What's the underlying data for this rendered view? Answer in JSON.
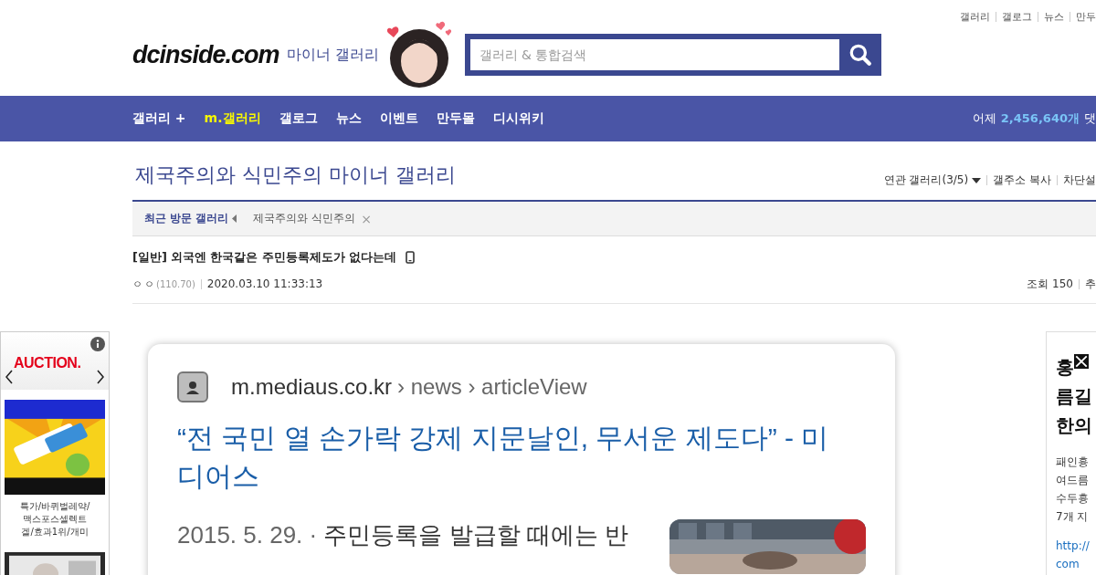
{
  "top_links": [
    "갤러리",
    "갤로그",
    "뉴스",
    "만두"
  ],
  "logo": "dcinside.com",
  "gallery_type": "마이너 갤러리",
  "search": {
    "placeholder": "갤러리 & 통합검색"
  },
  "nav": [
    {
      "label": "갤러리 +",
      "selected": false
    },
    {
      "label": "m.갤러리",
      "selected": true
    },
    {
      "label": "갤로그",
      "selected": false
    },
    {
      "label": "뉴스",
      "selected": false
    },
    {
      "label": "이벤트",
      "selected": false
    },
    {
      "label": "만두몰",
      "selected": false
    },
    {
      "label": "디시위키",
      "selected": false
    }
  ],
  "stats": {
    "label": "어제",
    "count": "2,456,640개",
    "suffix": "댓"
  },
  "gallery_title": "제국주의와 식민주의 마이너 갤러리",
  "gallery_links": [
    "연관 갤러리(3/5)",
    "갤주소 복사",
    "차단설"
  ],
  "recent": {
    "label": "최근 방문 갤러리",
    "items": [
      "제국주의와 식민주의"
    ],
    "close": "×"
  },
  "post": {
    "category": "[일반]",
    "title": "외국엔 한국같은 주민등록제도가 없다는데",
    "author": "ㅇㅇ",
    "ip": "(110.70)",
    "date": "2020.03.10 11:33:13",
    "views": "조회 150",
    "next": "추"
  },
  "left_ad": {
    "logo": "AUCTION.",
    "caption": [
      "특가/바퀴벌레약/",
      "맥스포스셀렉트",
      "겔/효과1위/개미"
    ]
  },
  "embedded_result": {
    "site": "m.mediaus.co.kr",
    "path": "› news › articleView",
    "title": "“전 국민 열 손가락 강제 지문날인, 무서운 제도다” - 미디어스",
    "date": "2015. 5. 29. ·",
    "snippet": "주민등록을 발급할 때에는 반"
  },
  "right_ad": {
    "headline": [
      "홍",
      "름길",
      "한의"
    ],
    "body": [
      "패인흉",
      "여드름",
      "수두흉",
      "7개 지"
    ],
    "link": [
      "http://",
      "com"
    ]
  }
}
